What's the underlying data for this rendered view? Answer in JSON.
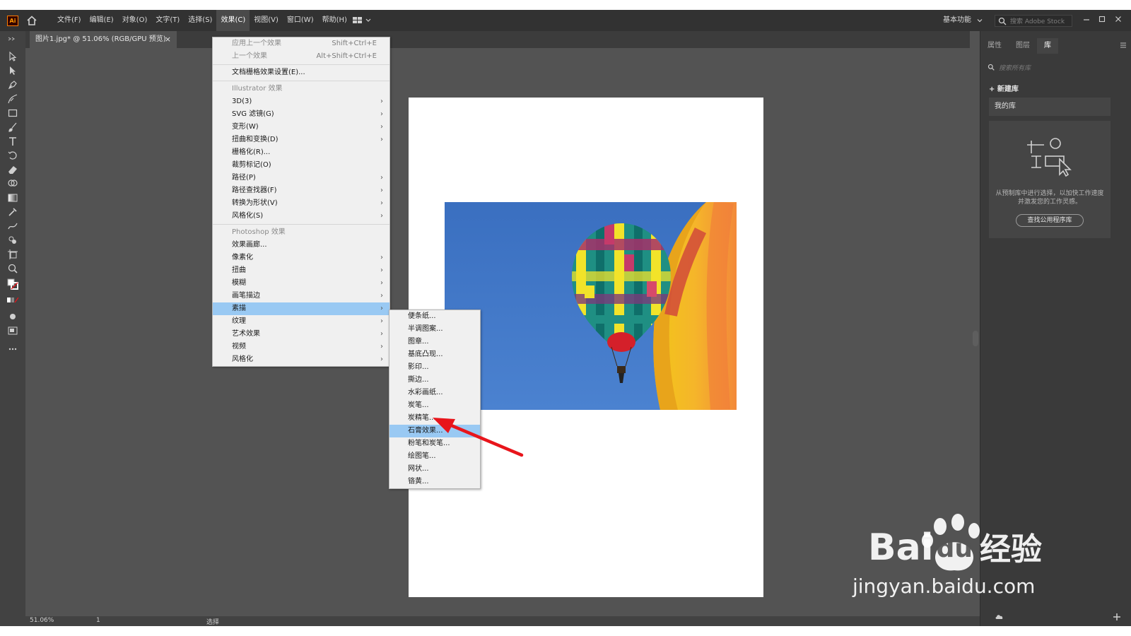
{
  "app": {
    "logo": "Ai",
    "menu": [
      "文件(F)",
      "编辑(E)",
      "对象(O)",
      "文字(T)",
      "选择(S)",
      "效果(C)",
      "视图(V)",
      "窗口(W)",
      "帮助(H)"
    ],
    "workspace": "基本功能",
    "stock_search_placeholder": "搜索 Adobe Stock"
  },
  "document": {
    "tab_title": "图片1.jpg* @ 51.06% (RGB/GPU 预览)",
    "close": "×"
  },
  "effects_menu": {
    "apply_last": "应用上一个效果",
    "apply_last_shortcut": "Shift+Ctrl+E",
    "last_effect": "上一个效果",
    "last_effect_shortcut": "Alt+Shift+Ctrl+E",
    "raster_settings": "文档栅格效果设置(E)...",
    "illustrator_header": "Illustrator 效果",
    "illustrator_items": [
      {
        "label": "3D(3)",
        "sub": true
      },
      {
        "label": "SVG 滤镜(G)",
        "sub": true
      },
      {
        "label": "变形(W)",
        "sub": true
      },
      {
        "label": "扭曲和变换(D)",
        "sub": true
      },
      {
        "label": "栅格化(R)...",
        "sub": false
      },
      {
        "label": "裁剪标记(O)",
        "sub": false
      },
      {
        "label": "路径(P)",
        "sub": true
      },
      {
        "label": "路径查找器(F)",
        "sub": true
      },
      {
        "label": "转换为形状(V)",
        "sub": true
      },
      {
        "label": "风格化(S)",
        "sub": true
      }
    ],
    "photoshop_header": "Photoshop 效果",
    "photoshop_items": [
      {
        "label": "效果画廊...",
        "sub": false
      },
      {
        "label": "像素化",
        "sub": true
      },
      {
        "label": "扭曲",
        "sub": true
      },
      {
        "label": "模糊",
        "sub": true
      },
      {
        "label": "画笔描边",
        "sub": true
      },
      {
        "label": "素描",
        "sub": true,
        "highlighted": true
      },
      {
        "label": "纹理",
        "sub": true
      },
      {
        "label": "艺术效果",
        "sub": true
      },
      {
        "label": "视频",
        "sub": true
      },
      {
        "label": "风格化",
        "sub": true
      }
    ]
  },
  "sketch_submenu": {
    "items": [
      "便条纸...",
      "半调图案...",
      "图章...",
      "基底凸现...",
      "影印...",
      "撕边...",
      "水彩画纸...",
      "炭笔...",
      "炭精笔...",
      "石膏效果...",
      "粉笔和炭笔...",
      "绘图笔...",
      "网状...",
      "铬黄..."
    ],
    "highlighted_index": 9
  },
  "right_panel": {
    "tabs": [
      "属性",
      "图层",
      "库"
    ],
    "active_tab": 2,
    "search_placeholder": "搜索所有库",
    "new_library": "+ 新建库",
    "my_library": "我的库",
    "empty_message": "从预制库中进行选择，以加快工作速度并激发您的工作灵感。",
    "find_button": "查找公用程序库"
  },
  "status": {
    "zoom": "51.06%",
    "page": "1",
    "tool": "选择"
  },
  "watermark": {
    "brand": "Bai",
    "brand_du": "du",
    "tag": "经验",
    "url": "jingyan.baidu.com"
  },
  "colors": {
    "chrome_dark": "#323232",
    "canvas_bg": "#535353",
    "menu_bg": "#f0f0f0",
    "menu_highlight": "#99c9f3",
    "sky": "#3d74c4",
    "arrow": "#e8151b"
  },
  "icons": {
    "toolbar": [
      "selection-tool-icon",
      "direct-selection-tool-icon",
      "pen-tool-icon",
      "curvature-tool-icon",
      "rectangle-tool-icon",
      "paintbrush-tool-icon",
      "type-tool-icon",
      "rotate-tool-icon",
      "eraser-tool-icon",
      "shape-builder-icon",
      "gradient-tool-icon",
      "eyedropper-tool-icon",
      "blend-tool-icon",
      "symbol-sprayer-icon",
      "artboard-tool-icon",
      "zoom-tool-icon"
    ]
  }
}
